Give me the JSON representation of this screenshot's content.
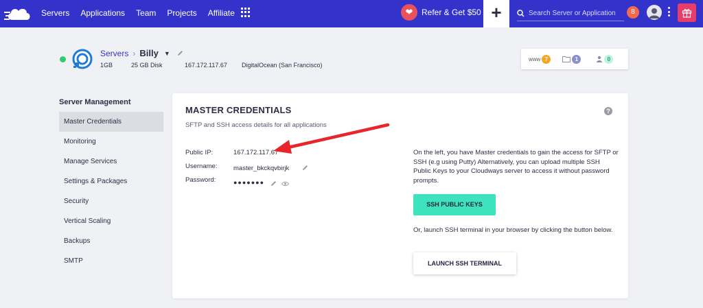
{
  "topbar": {
    "nav": [
      "Servers",
      "Applications",
      "Team",
      "Projects",
      "Affiliate"
    ],
    "refer_label": "Refer & Get $50",
    "search_placeholder": "Search Server or Application",
    "notification_count": "8",
    "bg_color": "#3333cc"
  },
  "server": {
    "breadcrumb_root": "Servers",
    "name": "Billy",
    "ram": "1GB",
    "disk": "25 GB Disk",
    "ip": "167.172.117.67",
    "provider": "DigitalOcean (San Francisco)",
    "status_color": "#2ecc71"
  },
  "counters": {
    "www_label": "www",
    "www_count": "7",
    "files_count": "1",
    "users_count": "0"
  },
  "sidebar": {
    "title": "Server Management",
    "items": [
      "Master Credentials",
      "Monitoring",
      "Manage Services",
      "Settings & Packages",
      "Security",
      "Vertical Scaling",
      "Backups",
      "SMTP"
    ]
  },
  "credentials": {
    "title": "MASTER CREDENTIALS",
    "subtitle": "SFTP and SSH access details for all applications",
    "public_ip_label": "Public IP:",
    "public_ip": "167.172.117.67",
    "username_label": "Username:",
    "username": "master_bkckqvbirjk",
    "password_label": "Password:",
    "password_mask": "●●●●●●●",
    "info_text": "On the left, you have Master credentials to gain the access for SFTP or SSH (e.g using Putty) Alternatively, you can upload multiple SSH Public Keys to your Cloudways server to access it without password prompts.",
    "ssh_keys_button": "SSH PUBLIC KEYS",
    "terminal_text": "Or, launch SSH terminal in your browser by clicking the button below.",
    "terminal_button": "LAUNCH SSH TERMINAL",
    "help_glyph": "?"
  },
  "colors": {
    "accent": "#3333cc",
    "ssh_button": "#3de3bd",
    "arrow": "#e8252a"
  }
}
